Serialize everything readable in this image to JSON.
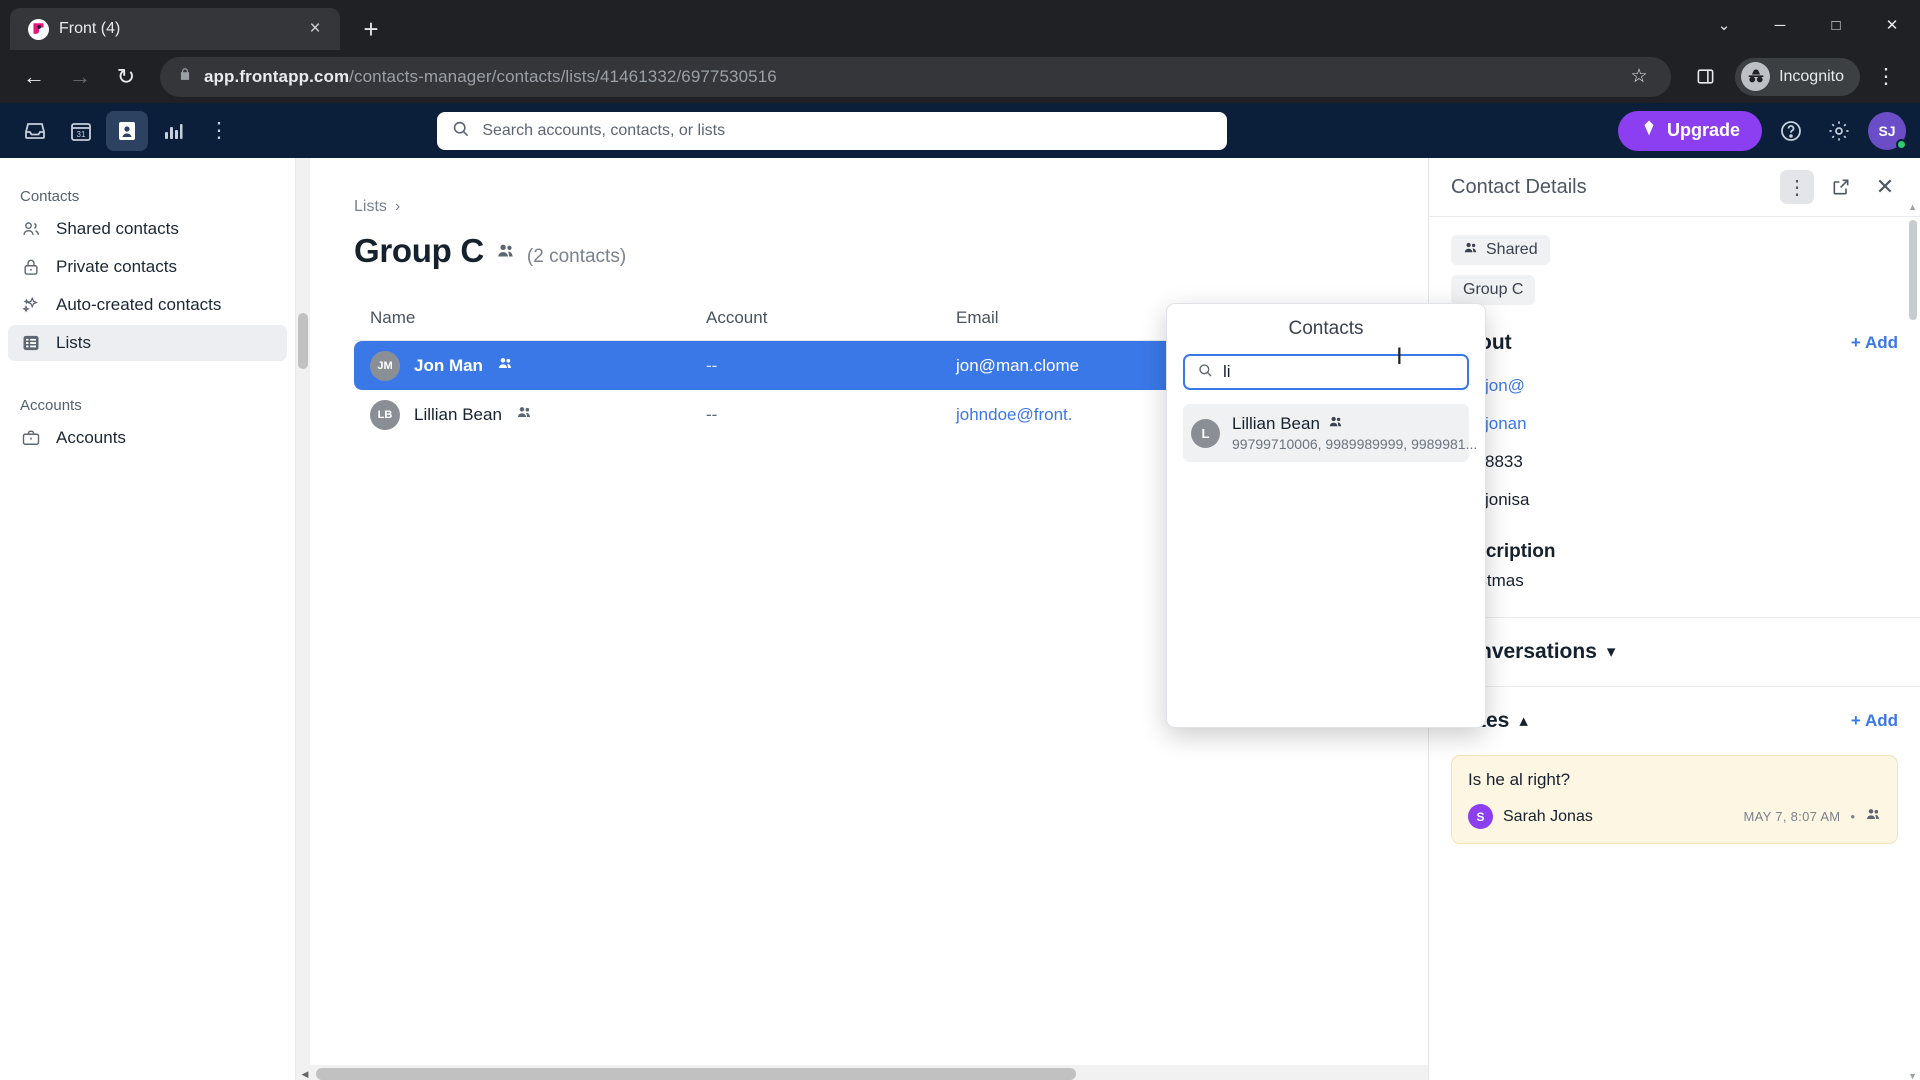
{
  "browser": {
    "tab": {
      "title": "Front (4)",
      "favicon": "front-logo-icon",
      "close": "×"
    },
    "new_tab_label": "+",
    "window_controls": {
      "minimize_all": "⌄",
      "minimize": "─",
      "maximize": "□",
      "close": "✕"
    },
    "nav": {
      "back": "←",
      "forward": "→",
      "reload": "↻"
    },
    "omnibox": {
      "lock_icon": "lock-icon",
      "domain": "app.frontapp.com",
      "path": "/contacts-manager/contacts/lists/41461332/6977530516",
      "star_icon": "☆",
      "sidepanel_icon": "side-panel-icon"
    },
    "incognito": {
      "label": "Incognito",
      "avatar_icon": "incognito-avatar-icon"
    },
    "menu_icon": "⋮"
  },
  "app_topbar": {
    "nav_items": [
      {
        "name": "inbox",
        "icon": "inbox-icon",
        "active": false
      },
      {
        "name": "calendar",
        "icon": "calendar-31-icon",
        "active": false
      },
      {
        "name": "contacts",
        "icon": "contact-card-icon",
        "active": true
      },
      {
        "name": "analytics",
        "icon": "bar-chart-icon",
        "active": false
      },
      {
        "name": "more",
        "icon": "⋮",
        "active": false
      }
    ],
    "search_placeholder": "Search accounts, contacts, or lists",
    "upgrade_label": "Upgrade",
    "help_icon": "question-circle-icon",
    "settings_icon": "gear-icon",
    "avatar_initials": "SJ"
  },
  "sidebar": {
    "sections": [
      {
        "label": "Contacts",
        "items": [
          {
            "label": "Shared contacts",
            "icon": "people-icon",
            "active": false
          },
          {
            "label": "Private contacts",
            "icon": "lock-icon",
            "active": false
          },
          {
            "label": "Auto-created contacts",
            "icon": "sparkles-icon",
            "active": false
          },
          {
            "label": "Lists",
            "icon": "list-icon",
            "active": true
          }
        ]
      },
      {
        "label": "Accounts",
        "items": [
          {
            "label": "Accounts",
            "icon": "briefcase-icon",
            "active": false
          }
        ]
      }
    ]
  },
  "main": {
    "breadcrumb": {
      "root": "Lists",
      "separator": "›"
    },
    "title": "Group C",
    "title_group_icon": "people-icon",
    "contact_count": "(2 contacts)",
    "table": {
      "headers": [
        "Name",
        "Account",
        "Email"
      ],
      "rows": [
        {
          "initials": "JM",
          "name": "Jon Man",
          "shared_icon": "people-icon",
          "account": "--",
          "email": "jon@man.clome",
          "selected": true
        },
        {
          "initials": "LB",
          "name": "Lillian Bean",
          "shared_icon": "people-icon",
          "account": "--",
          "email": "johndoe@front.",
          "selected": false
        }
      ]
    }
  },
  "details": {
    "title": "Contact Details",
    "more_icon": "⋮",
    "open_icon": "open-external-icon",
    "close_icon": "✕",
    "chips": [
      {
        "label": "Shared",
        "icon": "people-icon"
      },
      {
        "label": "Group C",
        "icon": ""
      }
    ],
    "about": {
      "title": "About",
      "add_label": "+ Add",
      "fields": [
        {
          "icon": "envelope-icon",
          "value": "jon@"
        },
        {
          "icon": "envelope-icon",
          "value": "jonan"
        },
        {
          "icon": "phone-icon",
          "value": "8833"
        },
        {
          "icon": "twitter-icon",
          "value": "jonisa"
        }
      ],
      "description_label": "Description",
      "description_value": "christmas"
    },
    "conversations": {
      "title": "Conversations",
      "chevron": "▾"
    },
    "notes": {
      "title": "Notes",
      "chevron": "▴",
      "add_label": "+ Add",
      "items": [
        {
          "text": "Is he al right?",
          "author_initial": "S",
          "author": "Sarah Jonas",
          "timestamp": "MAY 7, 8:07 AM",
          "separator": "•",
          "visibility_icon": "people-icon"
        }
      ]
    }
  },
  "popover": {
    "title": "Contacts",
    "search_icon": "search-icon",
    "search_value": "li",
    "results": [
      {
        "initial": "L",
        "name": "Lillian Bean",
        "shared_icon": "people-icon",
        "subtitle": "99799710006, 9989989999, 9989981..."
      }
    ]
  },
  "colors": {
    "accent_blue": "#3b78e7",
    "app_navy": "#0b1f3a",
    "upgrade_purple": "#8b3ff0",
    "note_yellow": "#fdf6e3"
  }
}
